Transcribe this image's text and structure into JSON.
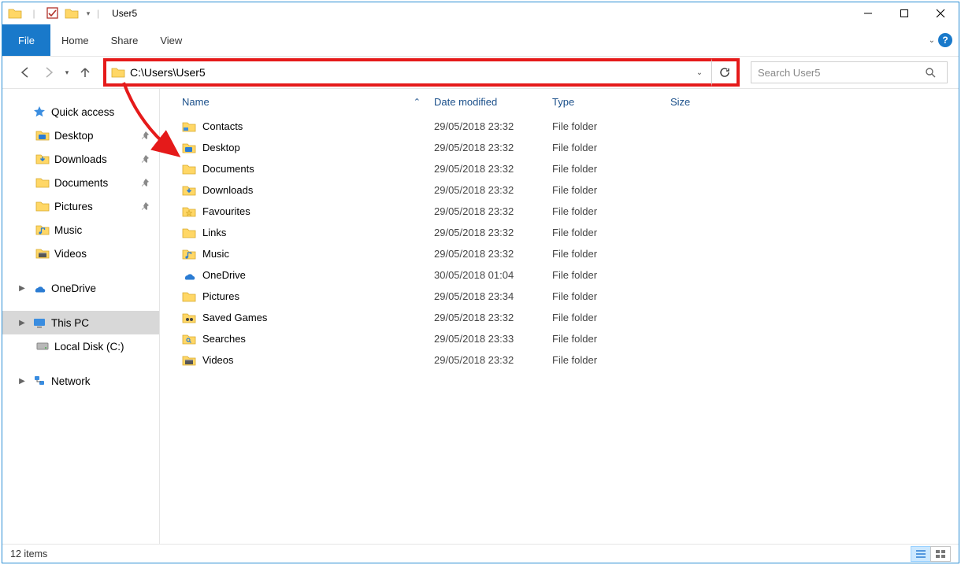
{
  "titlebar": {
    "title": "User5",
    "separator": "|"
  },
  "ribbon": {
    "tabs": {
      "file": "File",
      "home": "Home",
      "share": "Share",
      "view": "View"
    }
  },
  "nav": {
    "address_value": "C:\\Users\\User5",
    "search_placeholder": "Search User5"
  },
  "navpane": {
    "quick_access": "Quick access",
    "quick_children": [
      {
        "label": "Desktop",
        "pinned": true
      },
      {
        "label": "Downloads",
        "pinned": true
      },
      {
        "label": "Documents",
        "pinned": true
      },
      {
        "label": "Pictures",
        "pinned": true
      },
      {
        "label": "Music",
        "pinned": false
      },
      {
        "label": "Videos",
        "pinned": false
      }
    ],
    "onedrive": "OneDrive",
    "this_pc": "This PC",
    "local_disk": "Local Disk (C:)",
    "network": "Network"
  },
  "columns": {
    "name": "Name",
    "date": "Date modified",
    "type": "Type",
    "size": "Size"
  },
  "rows": [
    {
      "name": "Contacts",
      "date": "29/05/2018 23:32",
      "type": "File folder",
      "icon": "contacts"
    },
    {
      "name": "Desktop",
      "date": "29/05/2018 23:32",
      "type": "File folder",
      "icon": "desktop"
    },
    {
      "name": "Documents",
      "date": "29/05/2018 23:32",
      "type": "File folder",
      "icon": "folder"
    },
    {
      "name": "Downloads",
      "date": "29/05/2018 23:32",
      "type": "File folder",
      "icon": "downloads"
    },
    {
      "name": "Favourites",
      "date": "29/05/2018 23:32",
      "type": "File folder",
      "icon": "favourites"
    },
    {
      "name": "Links",
      "date": "29/05/2018 23:32",
      "type": "File folder",
      "icon": "folder"
    },
    {
      "name": "Music",
      "date": "29/05/2018 23:32",
      "type": "File folder",
      "icon": "music"
    },
    {
      "name": "OneDrive",
      "date": "30/05/2018 01:04",
      "type": "File folder",
      "icon": "onedrive"
    },
    {
      "name": "Pictures",
      "date": "29/05/2018 23:34",
      "type": "File folder",
      "icon": "folder"
    },
    {
      "name": "Saved Games",
      "date": "29/05/2018 23:32",
      "type": "File folder",
      "icon": "games"
    },
    {
      "name": "Searches",
      "date": "29/05/2018 23:33",
      "type": "File folder",
      "icon": "search"
    },
    {
      "name": "Videos",
      "date": "29/05/2018 23:32",
      "type": "File folder",
      "icon": "videos"
    }
  ],
  "statusbar": {
    "count_text": "12 items"
  }
}
